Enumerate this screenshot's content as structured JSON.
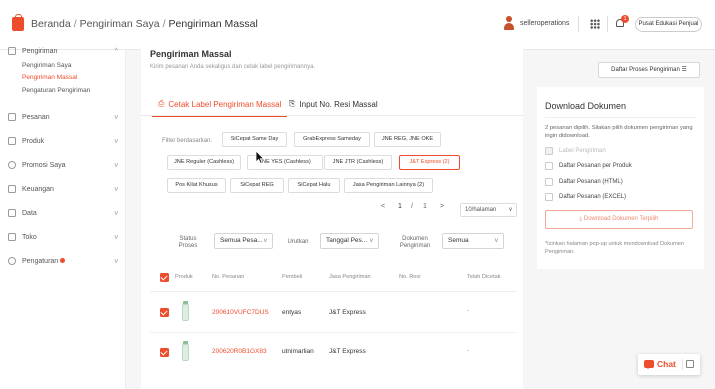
{
  "header": {
    "breadcrumb": [
      "Beranda",
      "Pengiriman Saya",
      "Pengiriman Massal"
    ],
    "user_name": "selleroperations",
    "notification_count": "1",
    "help_button": "Pusat Edukasi Penjual"
  },
  "sidebar": {
    "sections": [
      {
        "label": "Pengiriman",
        "icon": "box-icon",
        "expanded": true
      },
      {
        "label": "Pesanan",
        "icon": "order-icon"
      },
      {
        "label": "Produk",
        "icon": "product-icon"
      },
      {
        "label": "Promosi Saya",
        "icon": "promo-icon"
      },
      {
        "label": "Keuangan",
        "icon": "wallet-icon"
      },
      {
        "label": "Data",
        "icon": "chart-icon"
      },
      {
        "label": "Toko",
        "icon": "shop-icon"
      },
      {
        "label": "Pengaturan",
        "icon": "settings-icon"
      }
    ],
    "sub_items": [
      "Pengiriman Saya",
      "Pengiriman Massal",
      "Pengaturan Pengiriman"
    ],
    "active_sub": "Pengiriman Massal"
  },
  "main": {
    "title": "Pengiriman Massal",
    "description": "Kirim pesanan Anda sekaligus dan cetak label pengirimannya.",
    "daftar_button": "Daftar Proses Pengiriman",
    "tabs": [
      "Cetak Label Pengiriman Massal",
      "Input No. Resi Massal"
    ],
    "filter_label": "Filter berdasarkan:",
    "chips": [
      "SiCepat Same Day",
      "GrabExpress Sameday",
      "JNE REG, JNE OKE",
      "JNE Reguler (Cashless)",
      "JNE YES (Cashless)",
      "JNE JTR (Cashless)",
      "J&T Express (2)",
      "Pos Kilat Khusus",
      "SiCepat REG",
      "SiCepat Halu",
      "Jasa Pengiriman Lainnya (2)"
    ],
    "selected_chip": "J&T Express (2)",
    "pagination": {
      "prev": "<",
      "current": "1",
      "sep": "/",
      "total": "1",
      "next": ">",
      "per_page": "10/halaman"
    },
    "filters": {
      "status_label": "Status Proses",
      "status_value": "Semua Pesa...",
      "sort_label": "Urutkan",
      "sort_value": "Tanggal Pes...",
      "doc_label": "Dokumen Pengiriman",
      "doc_value": "Semua"
    },
    "columns": [
      "Produk",
      "No. Pesanan",
      "Pembeli",
      "Jasa Pengiriman",
      "No. Resi",
      "Telah Dicetak"
    ],
    "rows": [
      {
        "order_no": "200610VUFC7DUS",
        "buyer": "entyas",
        "courier": "J&T Express",
        "resi": "",
        "printed": "-"
      },
      {
        "order_no": "200620R0B1GX83",
        "buyer": "utnimarlian",
        "courier": "J&T Express",
        "resi": "",
        "printed": "-"
      }
    ]
  },
  "download": {
    "title": "Download Dokumen",
    "description": "2 pesanan dipilih. Silakan pilih dokumen pengiriman yang ingin didownload.",
    "options": [
      "Label Pengiriman",
      "Daftar Pesanan per Produk",
      "Daftar Pesanan (HTML)",
      "Daftar Pesanan (EXCEL)"
    ],
    "button": "Download Dokumen Terpilih",
    "note": "*Izinkan halaman pop-up untuk mendownload Dokumen Pengiriman."
  },
  "chat": {
    "label": "Chat"
  },
  "colors": {
    "accent": "#ee4d2d"
  }
}
